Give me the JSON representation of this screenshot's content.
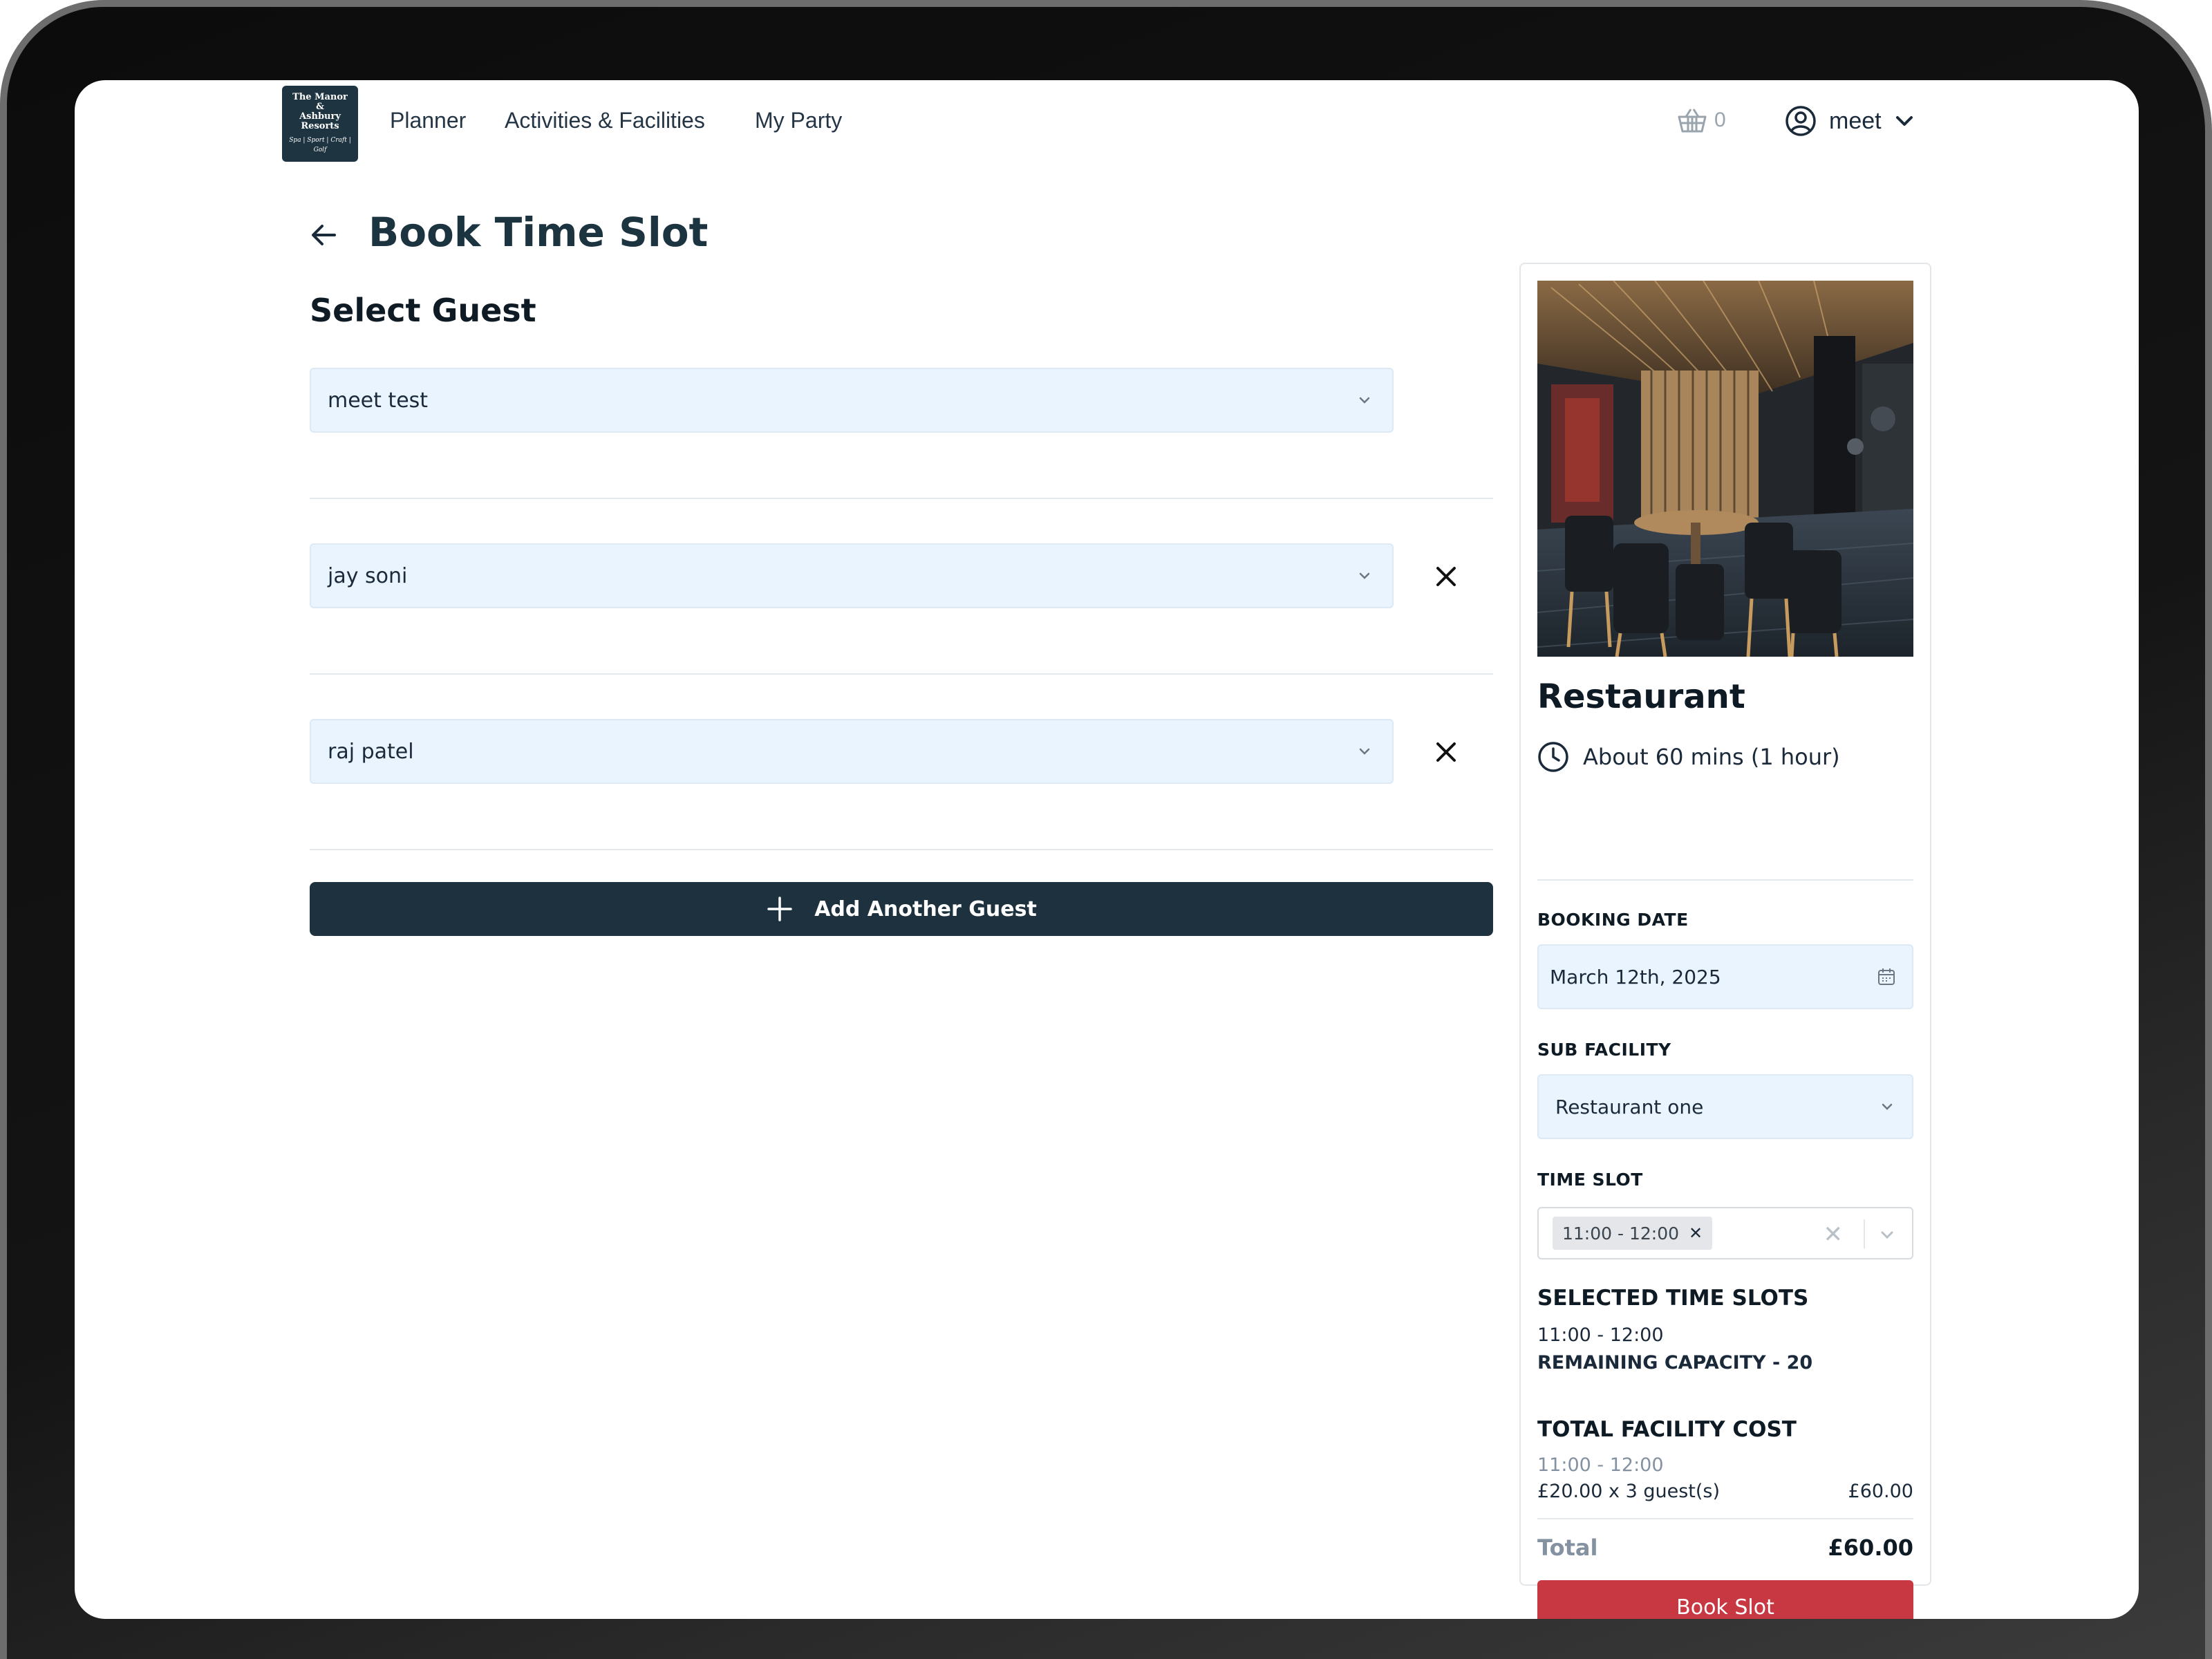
{
  "nav": {
    "logo_lines": [
      "The Manor",
      "&",
      "Ashbury",
      "Resorts"
    ],
    "logo_tagline": "Spa | Sport | Craft | Golf",
    "links": [
      "Planner",
      "Activities & Facilities",
      "My Party"
    ],
    "cart_count": "0",
    "user_name": "meet"
  },
  "page": {
    "title": "Book Time Slot",
    "section_title": "Select Guest"
  },
  "guests": [
    {
      "name": "meet test",
      "removable": false
    },
    {
      "name": "jay soni",
      "removable": true
    },
    {
      "name": "raj patel",
      "removable": true
    }
  ],
  "add_guest_label": "Add Another Guest",
  "card": {
    "title": "Restaurant",
    "duration": "About 60 mins (1 hour)",
    "booking_date_label": "BOOKING DATE",
    "booking_date_value": "March 12th, 2025",
    "sub_facility_label": "SUB FACILITY",
    "sub_facility_value": "Restaurant one",
    "time_slot_label": "TIME SLOT",
    "time_slot_chip": "11:00 - 12:00",
    "selected_slots_label": "SELECTED TIME SLOTS",
    "selected_slot": "11:00 - 12:00",
    "remaining_capacity": "REMAINING CAPACITY - 20",
    "total_cost_label": "TOTAL FACILITY COST",
    "cost_slot": "11:00 - 12:00",
    "cost_line": "£20.00 x 3 guest(s)",
    "cost_line_amount": "£60.00",
    "total_label": "Total",
    "total_value": "£60.00",
    "book_button": "Book Slot"
  },
  "colors": {
    "primary_dark": "#1d323e",
    "book_red": "#c73842",
    "field_bg": "#eaf4fe"
  }
}
